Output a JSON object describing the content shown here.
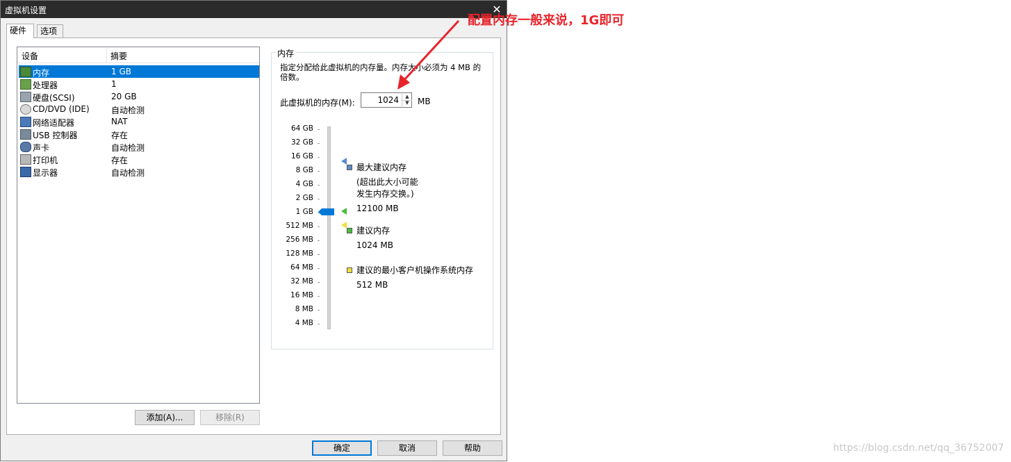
{
  "window": {
    "title": "虚拟机设置",
    "close_glyph": "✕"
  },
  "tabs": [
    {
      "label": "硬件"
    },
    {
      "label": "选项"
    }
  ],
  "device_list": {
    "columns": {
      "device": "设备",
      "summary": "摘要"
    },
    "rows": [
      {
        "name": "内存",
        "summary": "1 GB",
        "icon": "memory-icon",
        "selected": true
      },
      {
        "name": "处理器",
        "summary": "1",
        "icon": "processor-icon"
      },
      {
        "name": "硬盘(SCSI)",
        "summary": "20 GB",
        "icon": "hard-disk-icon"
      },
      {
        "name": "CD/DVD (IDE)",
        "summary": "自动检测",
        "icon": "cd-dvd-icon"
      },
      {
        "name": "网络适配器",
        "summary": "NAT",
        "icon": "network-adapter-icon"
      },
      {
        "name": "USB 控制器",
        "summary": "存在",
        "icon": "usb-icon"
      },
      {
        "name": "声卡",
        "summary": "自动检测",
        "icon": "sound-card-icon"
      },
      {
        "name": "打印机",
        "summary": "存在",
        "icon": "printer-icon"
      },
      {
        "name": "显示器",
        "summary": "自动检测",
        "icon": "display-icon"
      }
    ],
    "add_label": "添加(A)...",
    "remove_label": "移除(R)"
  },
  "memory": {
    "group_title": "内存",
    "description": "指定分配给此虚拟机的内存量。内存大小必须为 4 MB 的倍数。",
    "input_label": "此虚拟机的内存(M):",
    "value": "1024",
    "unit": "MB",
    "scale_labels": [
      "64 GB",
      "32 GB",
      "16 GB",
      "8 GB",
      "4 GB",
      "2 GB",
      "1 GB",
      "512 MB",
      "256 MB",
      "128 MB",
      "64 MB",
      "32 MB",
      "16 MB",
      "8 MB",
      "4 MB"
    ],
    "legend": {
      "max_title": "最大建议内存",
      "max_note": "(超出此大小可能发生内存交换。)",
      "max_value": "12100 MB",
      "rec_title": "建议内存",
      "rec_value": "1024 MB",
      "min_title": "建议的最小客户机操作系统内存",
      "min_value": "512 MB"
    },
    "colors": {
      "max": "#5a8cc8",
      "rec": "#4cbb3c",
      "min": "#f0e040"
    }
  },
  "footer": {
    "ok_label": "确定",
    "cancel_label": "取消",
    "help_label": "帮助"
  },
  "annotation": {
    "text": "配置内存一般来说，1G即可",
    "color": "#e8242b"
  },
  "watermark": "https://blog.csdn.net/qq_36752007"
}
